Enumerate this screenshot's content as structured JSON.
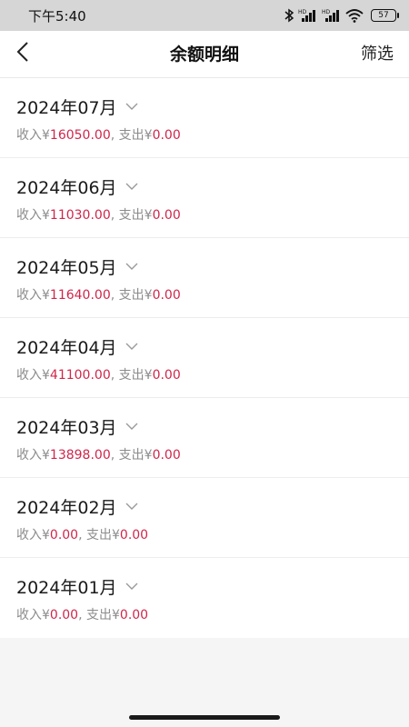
{
  "status_bar": {
    "time": "下午5:40",
    "battery": "57",
    "icons": [
      "bluetooth-icon",
      "signal-hd-icon",
      "signal-hd-icon",
      "wifi-icon",
      "battery-icon"
    ]
  },
  "header": {
    "back_icon": "chevron-left-icon",
    "title": "余额明细",
    "filter_label": "筛选"
  },
  "labels": {
    "income": "收入",
    "expense": "支出",
    "currency": "¥",
    "separator": ", "
  },
  "months": [
    {
      "label": "2024年07月",
      "income": "16050.00",
      "expense": "0.00"
    },
    {
      "label": "2024年06月",
      "income": "11030.00",
      "expense": "0.00"
    },
    {
      "label": "2024年05月",
      "income": "11640.00",
      "expense": "0.00"
    },
    {
      "label": "2024年04月",
      "income": "41100.00",
      "expense": "0.00"
    },
    {
      "label": "2024年03月",
      "income": "13898.00",
      "expense": "0.00"
    },
    {
      "label": "2024年02月",
      "income": "0.00",
      "expense": "0.00"
    },
    {
      "label": "2024年01月",
      "income": "0.00",
      "expense": "0.00"
    }
  ],
  "colors": {
    "amount": "#d0264a",
    "muted_text": "#8c8c8c",
    "page_background": "#f5f5f5"
  }
}
